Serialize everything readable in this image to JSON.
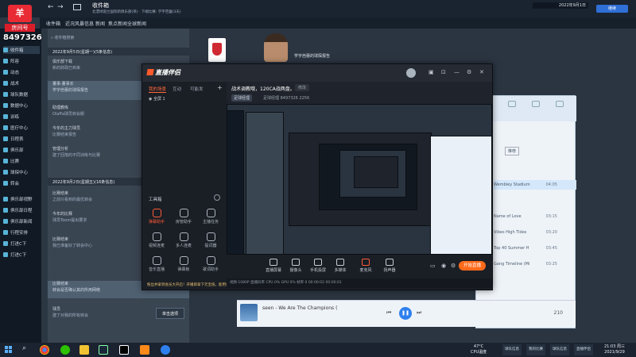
{
  "colors": {
    "accent_orange": "#ff6a1a",
    "game_bg": "#2c3744",
    "music_accent": "#2f80ed",
    "brand_red": "#e82b35"
  },
  "overlay": {
    "room_logo": "羊",
    "room_label": "房间号",
    "room_id": "8497326"
  },
  "game": {
    "screen_title": "收件箱",
    "screen_subtitle": "北漂绿茵兰国际新俱乐部(英) · 下端比赛: 学字芭蕾(3天)",
    "clock": "2022年9月1日",
    "continue": "继续",
    "nav_tabs": [
      "收件箱",
      "近况风暴信息",
      "新闻",
      "焦点新闻",
      "全球新闻"
    ],
    "sidebar": [
      "收件箱",
      "阵容",
      "动态",
      "战术",
      "球队数据",
      "数据中心",
      "训练",
      "医疗中心",
      "日程表",
      "俱乐部",
      "比赛",
      "球探中心",
      "转会",
      "俱乐部视野",
      "俱乐部日程",
      "俱乐部新闻",
      "行程安排",
      "打进C下",
      "打进C下"
    ],
    "search_placeholder": "收件箱搜索",
    "inbox_section_1": "2022年9月5日(星期一)(5条信息)",
    "inbox_section_2": "2022年9月2日(星期五)(16条信息)",
    "inbox": [
      {
        "title": "俱乐部下载",
        "sub": "新的财政已到来"
      },
      {
        "title": "董事·董事长",
        "sub": "学字芭蕾的球探报告"
      },
      {
        "title": "助理教练",
        "sub": "Olaffa球员转会期"
      },
      {
        "title": "今年的主力球员",
        "sub": "比赛结束报告"
      },
      {
        "title": "管理分析",
        "sub": "建了回落的不同训练与比赛"
      },
      {
        "title": "比赛结束",
        "sub": "之前只看到的最优转会"
      },
      {
        "title": "今年的比赛",
        "sub": "球员Toom提出要求"
      },
      {
        "title": "比赛结束",
        "sub": "我已准备好了转会中心"
      },
      {
        "title": "比赛结束",
        "sub": "转会是否确认其的所用网络"
      },
      {
        "title": "球员",
        "sub": "建了对我的所有转会"
      }
    ],
    "subscribe_button": "单击选项",
    "news_title": "学字芭蕾的球探报告"
  },
  "streaming_app": {
    "brand": "直播伴侣",
    "tabs": [
      "我的场景",
      "互动",
      "可能发"
    ],
    "scene": "全屏 1",
    "toolbox_title": "工具箱",
    "tools": [
      {
        "label": "弹幕助手",
        "icon": "danmaku-icon",
        "highlight": true
      },
      {
        "label": "房管助手",
        "icon": "admin-icon",
        "highlight": false
      },
      {
        "label": "主播任务",
        "icon": "task-icon",
        "highlight": false
      },
      {
        "label": "视频连麦",
        "icon": "video-link-icon",
        "highlight": false
      },
      {
        "label": "多人连麦",
        "icon": "multi-link-icon",
        "highlight": false
      },
      {
        "label": "提词器",
        "icon": "teleprompter-icon",
        "highlight": false
      },
      {
        "label": "音乐直播",
        "icon": "music-icon",
        "highlight": false
      },
      {
        "label": "弹幕板",
        "icon": "danmaku-board-icon",
        "highlight": false
      },
      {
        "label": "歌词助手",
        "icon": "lyrics-icon",
        "highlight": false
      }
    ],
    "room_title": "战术调教哦，120CA战两盘。",
    "edit_label": "修改",
    "category_tag": "足球经理",
    "meta_text": "足球经理  8497326  2256",
    "bottom_buttons": [
      "直播屏幕",
      "摄像头",
      "手机投屏",
      "多媒体",
      "麦克风",
      "扬声器"
    ],
    "go_live": "开始直播",
    "status_text": "视频·1080P   直播码率   CPU 0%   GPU 0%   帧率 0  00:00:02  00:00:01",
    "notice": "粉丝并拿到会员大开启！开播即拿下元宝值，能用还有大额奖"
  },
  "music": {
    "tracks": [
      {
        "title": "Wembley Stadium",
        "time": "04:05",
        "highlight": true
      },
      {
        "title": "Name of Love",
        "time": "03:15",
        "highlight": false
      },
      {
        "title": "Vibes High Tides",
        "time": "03:20",
        "highlight": false
      },
      {
        "title": "Top 40 Summer H",
        "time": "03:45",
        "highlight": false
      },
      {
        "title": "Gang Timeline (Mi",
        "time": "03:25",
        "highlight": false
      }
    ],
    "sort_label": "推荐",
    "now_playing": "seen - We Are The Champions (",
    "volume": "210"
  },
  "taskbar": {
    "tasks": [
      "球队信息",
      "我的比赛",
      "球队信息",
      "直播伴侣",
      "球队比赛信息"
    ],
    "temp": "47°C",
    "temp_label": "CPU温度",
    "time": "21:03 周三",
    "date": "2021/9/29"
  }
}
